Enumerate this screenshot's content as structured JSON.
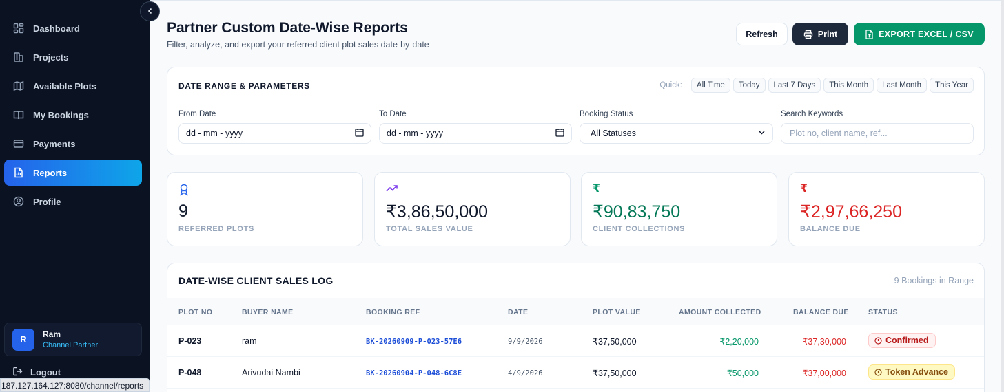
{
  "sidebar": {
    "items": [
      {
        "label": "Dashboard",
        "icon": "dashboard-icon"
      },
      {
        "label": "Projects",
        "icon": "building-icon"
      },
      {
        "label": "Available Plots",
        "icon": "map-icon"
      },
      {
        "label": "My Bookings",
        "icon": "book-icon"
      },
      {
        "label": "Payments",
        "icon": "credit-card-icon"
      },
      {
        "label": "Reports",
        "icon": "report-icon",
        "active": true
      },
      {
        "label": "Profile",
        "icon": "user-circle-icon"
      }
    ],
    "user": {
      "initial": "R",
      "name": "Ram",
      "role": "Channel Partner"
    },
    "logout_label": "Logout"
  },
  "status_url": "187.127.164.127:8080/channel/reports",
  "header": {
    "title": "Partner Custom Date-Wise Reports",
    "subtitle": "Filter, analyze, and export your referred client plot sales date-by-date",
    "refresh_label": "Refresh",
    "print_label": "Print",
    "export_label": "EXPORT EXCEL / CSV"
  },
  "filters": {
    "title": "DATE RANGE & PARAMETERS",
    "quick_label": "Quick:",
    "quick_options": [
      "All Time",
      "Today",
      "Last 7 Days",
      "This Month",
      "Last Month",
      "This Year"
    ],
    "from_label": "From Date",
    "from_value": "dd - mm - yyyy",
    "to_label": "To Date",
    "to_value": "dd - mm - yyyy",
    "status_label": "Booking Status",
    "status_value": "All Statuses",
    "search_label": "Search Keywords",
    "search_placeholder": "Plot no, client name, ref..."
  },
  "stats": [
    {
      "value": "9",
      "label": "REFERRED PLOTS",
      "icon": "award-icon",
      "color": "#0f172a",
      "icon_color": "#2563eb"
    },
    {
      "value": "₹3,86,50,000",
      "label": "TOTAL SALES VALUE",
      "icon": "trending-up-icon",
      "color": "#0f172a",
      "icon_color": "#7c3aed"
    },
    {
      "value": "₹90,83,750",
      "label": "CLIENT COLLECTIONS",
      "icon": "rupee-icon",
      "color": "#047857",
      "icon_color": "#059669"
    },
    {
      "value": "₹2,97,66,250",
      "label": "BALANCE DUE",
      "icon": "rupee-icon",
      "color": "#dc2626",
      "icon_color": "#dc2626"
    }
  ],
  "table": {
    "title": "DATE-WISE CLIENT SALES LOG",
    "count": "9 Bookings in Range",
    "headers": [
      "PLOT NO",
      "BUYER NAME",
      "BOOKING REF",
      "DATE",
      "PLOT VALUE",
      "AMOUNT COLLECTED",
      "BALANCE DUE",
      "STATUS"
    ],
    "rows": [
      {
        "plot": "P-023",
        "buyer": "ram",
        "ref": "BK-20260909-P-023-57E6",
        "date": "9/9/2026",
        "value": "₹37,50,000",
        "collected": "₹2,20,000",
        "balance": "₹37,30,000",
        "status": "Confirmed"
      },
      {
        "plot": "P-048",
        "buyer": "Arivudai Nambi",
        "ref": "BK-20260904-P-048-6C8E",
        "date": "4/9/2026",
        "value": "₹37,50,000",
        "collected": "₹50,000",
        "balance": "₹37,00,000",
        "status": "Token Advance"
      }
    ]
  },
  "colors": {
    "accent": "#2563eb",
    "success": "#059669",
    "danger": "#dc2626",
    "sidebar": "#0b1222"
  }
}
